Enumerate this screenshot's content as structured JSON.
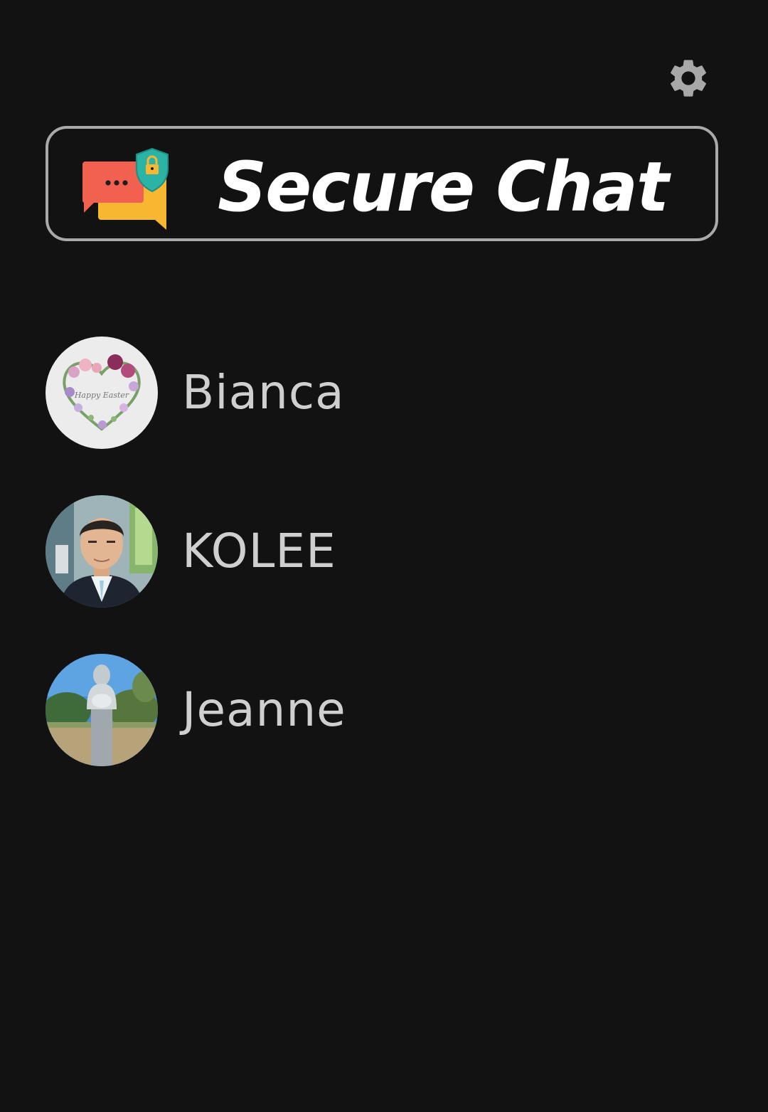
{
  "header": {
    "app_title": "Secure Chat",
    "settings_icon": "gear-icon",
    "logo_icon": "secure-chat-logo-icon"
  },
  "contacts": [
    {
      "name": "Bianca",
      "avatar_icon": "floral-heart-avatar"
    },
    {
      "name": "KOLEE",
      "avatar_icon": "man-portrait-avatar"
    },
    {
      "name": "Jeanne",
      "avatar_icon": "statue-photo-avatar"
    }
  ],
  "colors": {
    "background": "#121212",
    "banner_border": "#a9a9a9",
    "title_text": "#ffffff",
    "contact_text": "#cfcfcf",
    "gear": "#a8a8a8"
  }
}
